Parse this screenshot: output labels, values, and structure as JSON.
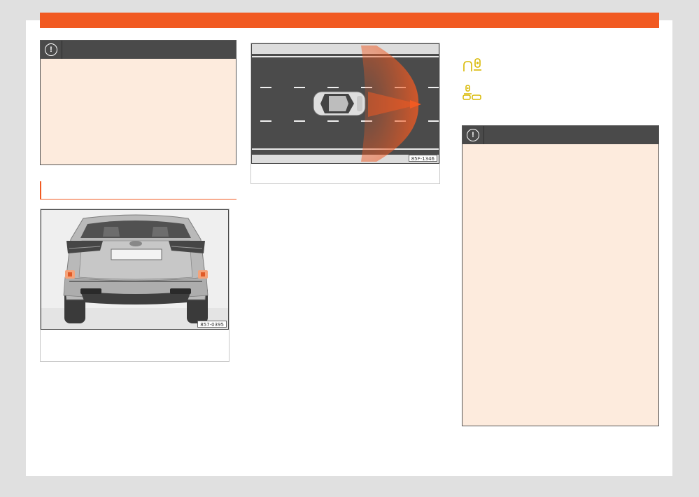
{
  "page": {
    "colors": {
      "accent": "#f15a22",
      "warning_bg": "#fdebdd",
      "warning_head": "#4a4a4a",
      "background": "#e0e0e0"
    }
  },
  "warning_boxes": [
    {
      "icon": "exclamation-icon",
      "symbol": "!"
    },
    {
      "icon": "exclamation-icon",
      "symbol": "!"
    }
  ],
  "figures": [
    {
      "id": "rear-vehicle-sensors",
      "code": "857-0395",
      "badge": "SEAT"
    },
    {
      "id": "sensor-coverage-road",
      "code": "85F-1346"
    }
  ],
  "side_symbols": [
    {
      "icon": "parking-sensor-icon"
    },
    {
      "icon": "traffic-sensor-icon"
    }
  ]
}
